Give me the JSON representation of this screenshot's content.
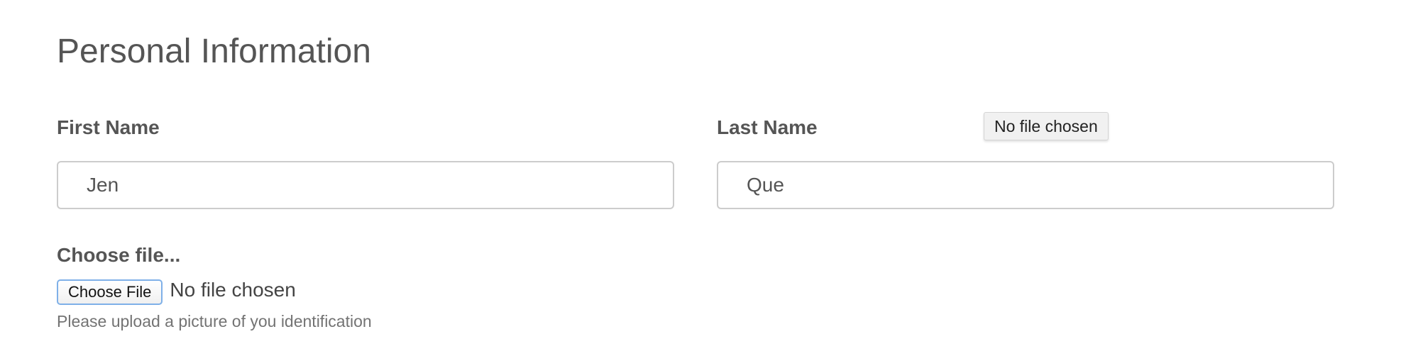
{
  "form": {
    "title": "Personal Information",
    "first_name": {
      "label": "First Name",
      "value": "Jen"
    },
    "last_name": {
      "label": "Last Name",
      "value": "Que"
    },
    "file": {
      "label": "Choose file...",
      "button_label": "Choose File",
      "status": "No file chosen",
      "help": "Please upload a picture of you identification"
    },
    "tooltip": "No file chosen"
  }
}
